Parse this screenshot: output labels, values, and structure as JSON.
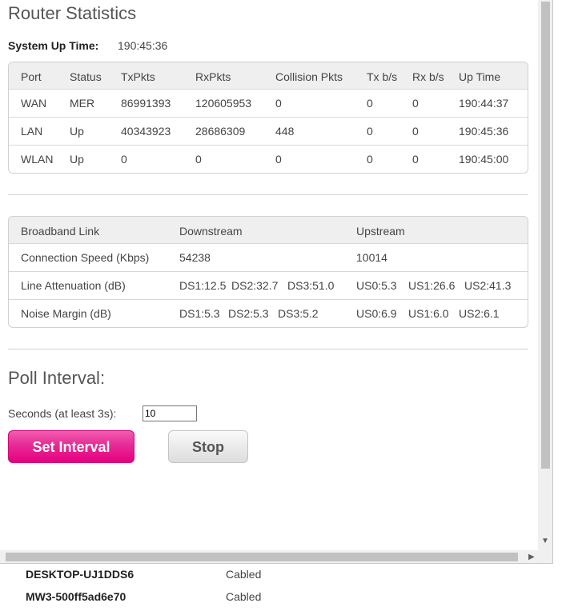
{
  "page_title": "Router Statistics",
  "system_up_time": {
    "label": "System Up Time:",
    "value": "190:45:36"
  },
  "port_table": {
    "headers": [
      "Port",
      "Status",
      "TxPkts",
      "RxPkts",
      "Collision Pkts",
      "Tx b/s",
      "Rx b/s",
      "Up Time"
    ],
    "rows": [
      [
        "WAN",
        "MER",
        "86991393",
        "120605953",
        "0",
        "0",
        "0",
        "190:44:37"
      ],
      [
        "LAN",
        "Up",
        "40343923",
        "28686309",
        "448",
        "0",
        "0",
        "190:45:36"
      ],
      [
        "WLAN",
        "Up",
        "0",
        "0",
        "0",
        "0",
        "0",
        "190:45:00"
      ]
    ]
  },
  "broadband_table": {
    "headers": [
      "Broadband Link",
      "Downstream",
      "Upstream"
    ],
    "rows": [
      {
        "label": "Connection Speed (Kbps)",
        "down": [
          "54238"
        ],
        "up": [
          "10014"
        ]
      },
      {
        "label": "Line Attenuation (dB)",
        "down": [
          "DS1:12.5",
          "DS2:32.7",
          "DS3:51.0"
        ],
        "up": [
          "US0:5.3",
          "US1:26.6",
          "US2:41.3"
        ]
      },
      {
        "label": "Noise Margin (dB)",
        "down": [
          "DS1:5.3",
          "DS2:5.3",
          "DS3:5.2"
        ],
        "up": [
          "US0:6.9",
          "US1:6.0",
          "US2:6.1"
        ]
      }
    ]
  },
  "poll": {
    "title": "Poll Interval:",
    "seconds_label": "Seconds (at least 3s):",
    "seconds_value": "10",
    "set_button": "Set Interval",
    "stop_button": "Stop"
  },
  "devices": [
    {
      "name": "DESKTOP-UJ1DDS6",
      "connection": "Cabled"
    },
    {
      "name": "MW3-500ff5ad6e70",
      "connection": "Cabled"
    }
  ],
  "colors": {
    "accent": "#e5007f",
    "table_header_bg": "#efefef"
  }
}
